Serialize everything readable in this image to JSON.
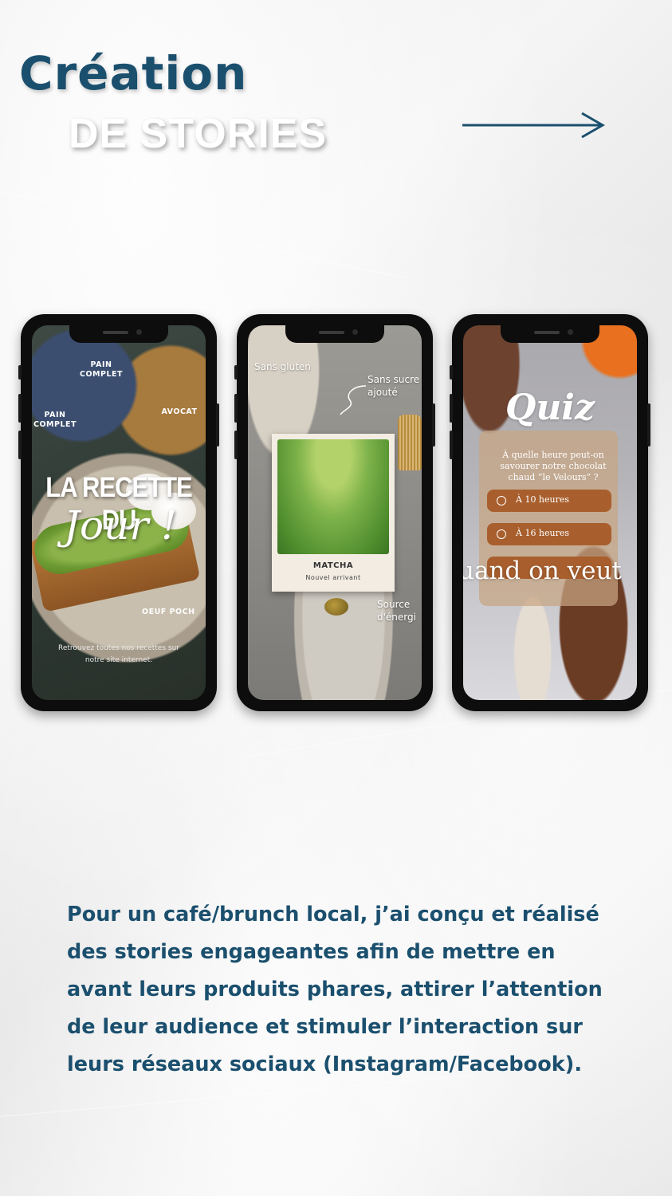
{
  "header": {
    "title": "Création",
    "subtitle": "DE STORIES",
    "arrow_icon": "arrow-right-icon",
    "title_color": "#1b4f6e"
  },
  "stories": [
    {
      "labels": [
        "PAIN COMPLET",
        "PAIN COMPLET",
        "AVOCAT",
        "OEUF POCH"
      ],
      "headline": "LA RECETTE DU",
      "script": "Jour !",
      "footer": "Retrouvez toutes nos recettes sur notre site internet."
    },
    {
      "notes": [
        "Sans gluten",
        "Sans sucre ajouté",
        "Source d'énergi"
      ],
      "product": "MATCHA",
      "tag": "Nouvel arrivant"
    },
    {
      "title": "Quiz",
      "question": "À quelle heure peut-on savourer notre chocolat chaud “le Velours” ?",
      "options": [
        "À 10 heures",
        "À 16 heures"
      ],
      "overlay": "uand on veut"
    }
  ],
  "description": "Pour un café/brunch local, j’ai conçu et réalisé des stories engageantes afin de mettre en avant leurs produits phares, attirer l’attention de leur audience et stimuler l’interaction sur leurs réseaux sociaux (Instagram/Facebook)."
}
